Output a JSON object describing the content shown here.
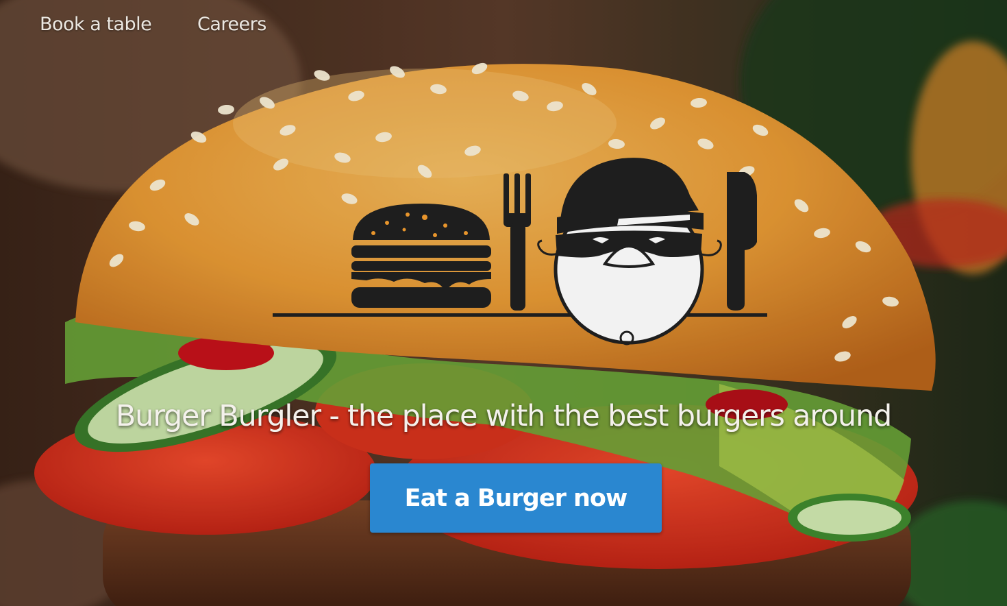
{
  "nav": {
    "items": [
      {
        "label": "Book a table"
      },
      {
        "label": "Careers"
      }
    ]
  },
  "hero": {
    "background": "burger-photo",
    "logo_icon": "burger-burgler-logo",
    "tagline": "Burger Burgler - the place with the best burgers around",
    "cta_label": "Eat a Burger now"
  },
  "colors": {
    "cta_background": "#2a87d0",
    "text": "#f4f1ec",
    "logo_dark": "#1e1e1e"
  }
}
